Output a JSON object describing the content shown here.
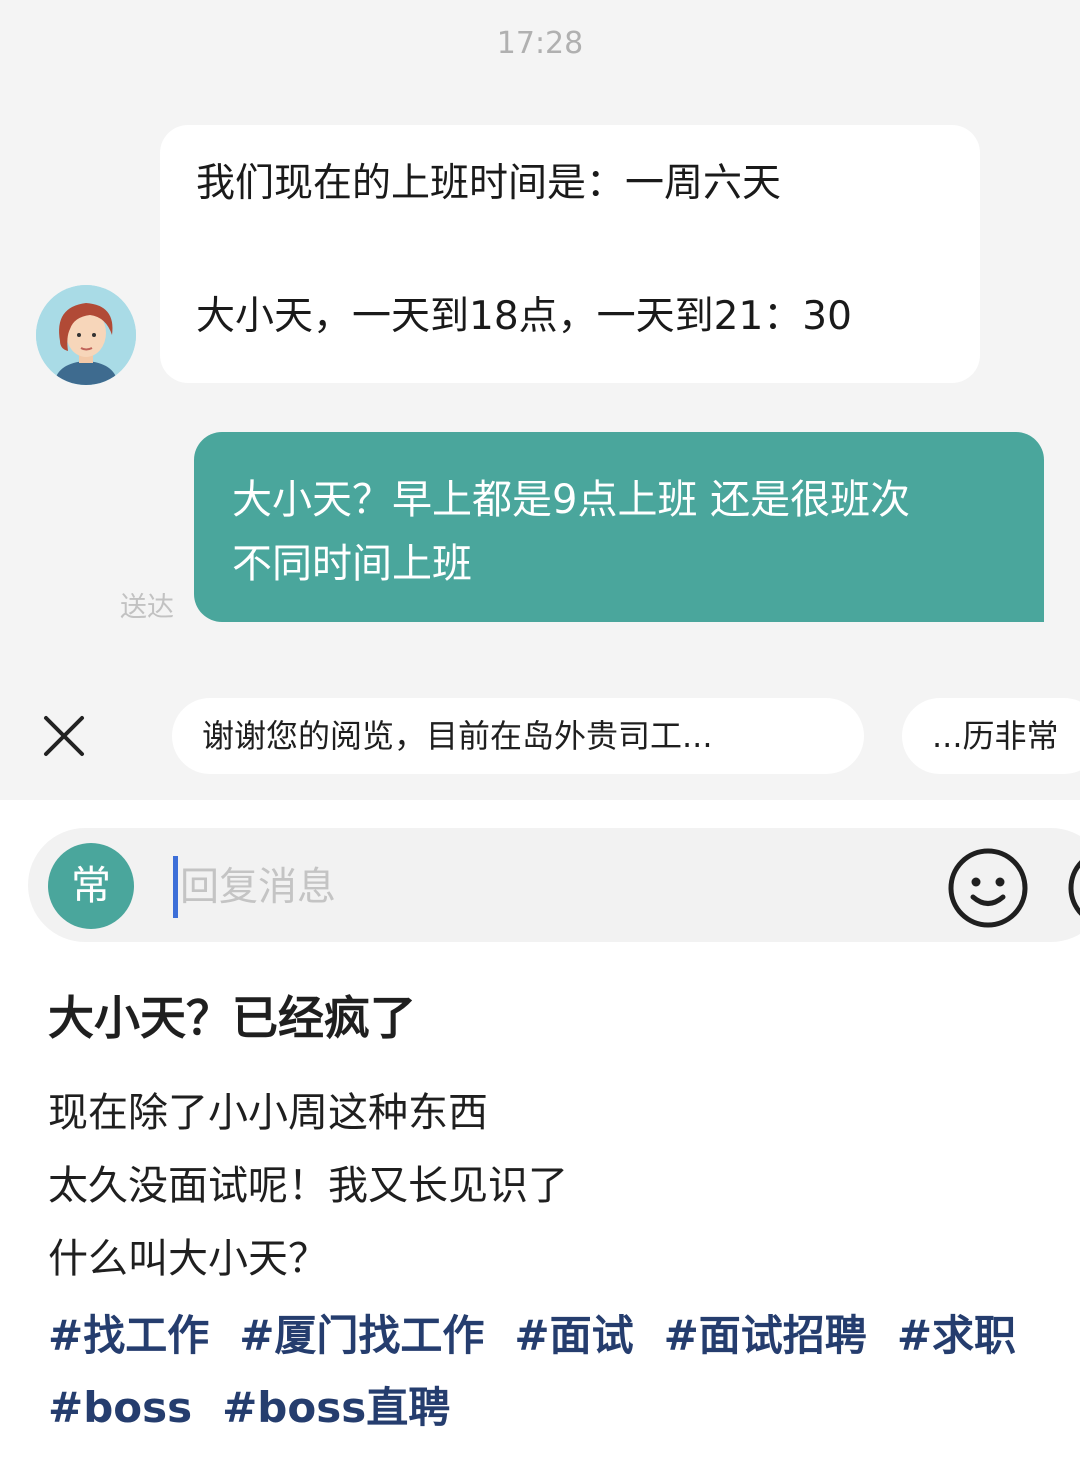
{
  "chat": {
    "timestamp": "17:28",
    "incoming": {
      "line1": "我们现在的上班时间是：一周六天",
      "line2": "大小天，一天到18点，一天到21：30"
    },
    "outgoing": {
      "line1": "大小天？早上都是9点上班 还是很班次",
      "line2": "不同时间上班",
      "status": "送达"
    }
  },
  "suggestions": [
    "谢谢您的阅览，目前在岛外贵司工...",
    "...历非常"
  ],
  "composer": {
    "quick_reply_label": "常",
    "placeholder": "回复消息"
  },
  "post": {
    "title": "大小天？已经疯了",
    "lines": [
      "现在除了小小周这种东西",
      "太久没面试呢！我又长见识了",
      "什么叫大小天？"
    ],
    "tags": [
      "#找工作",
      "#厦门找工作",
      "#面试",
      "#面试招聘",
      "#求职",
      "#boss",
      "#boss直聘"
    ]
  },
  "colors": {
    "accent_teal": "#4aa69c",
    "chat_background": "#f4f4f4",
    "tag_color": "#253d6e"
  },
  "icons": [
    "close-icon",
    "emoji-icon",
    "more-icon",
    "avatar"
  ]
}
